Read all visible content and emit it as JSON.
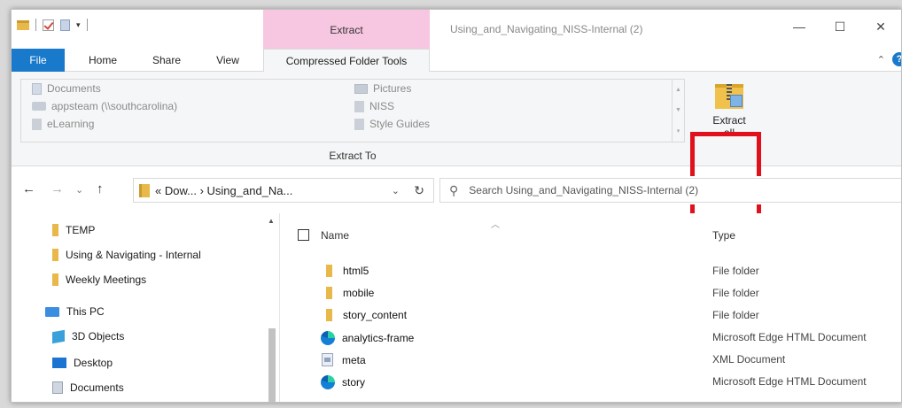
{
  "window": {
    "title": "Using_and_Navigating_NISS-Internal (2)",
    "context_tab_label": "Extract",
    "controls": {
      "minimize": "—",
      "maximize": "☐",
      "close": "✕"
    }
  },
  "qat": {
    "dropdown": "▾"
  },
  "tabs": {
    "file": "File",
    "home": "Home",
    "share": "Share",
    "view": "View",
    "compressed": "Compressed Folder Tools"
  },
  "tabrow_right": {
    "collapse": "⌃",
    "help": "?"
  },
  "ribbon": {
    "gallery": [
      {
        "label": "Documents",
        "icon": "documents-icon"
      },
      {
        "label": "appsteam (\\\\southcarolina)",
        "icon": "network-drive-icon"
      },
      {
        "label": "eLearning",
        "icon": "folder-icon"
      },
      {
        "label": "Pictures",
        "icon": "pictures-icon"
      },
      {
        "label": "NISS",
        "icon": "folder-icon"
      },
      {
        "label": "Style Guides",
        "icon": "folder-icon"
      }
    ],
    "group_label": "Extract To",
    "extract_all": {
      "line1": "Extract",
      "line2": "all"
    },
    "highlight_color": "#e0111c"
  },
  "navbar": {
    "back": "←",
    "forward": "→",
    "recent": "⌄",
    "up": "↑",
    "breadcrumb": "« Dow... › Using_and_Na...",
    "dropdown": "⌄",
    "refresh": "↻",
    "search_placeholder": "Search Using_and_Navigating_NISS-Internal (2)",
    "search_icon": "⚲"
  },
  "navpane": {
    "items": [
      {
        "label": "TEMP",
        "icon": "folder-icon"
      },
      {
        "label": "Using & Navigating - Internal",
        "icon": "folder-icon"
      },
      {
        "label": "Weekly Meetings",
        "icon": "folder-icon"
      },
      {
        "label": "This PC",
        "icon": "pc-icon"
      },
      {
        "label": "3D Objects",
        "icon": "3d-objects-icon"
      },
      {
        "label": "Desktop",
        "icon": "desktop-icon"
      },
      {
        "label": "Documents",
        "icon": "documents-icon"
      }
    ],
    "scroll_up": "▲"
  },
  "filelist": {
    "columns": {
      "name": "Name",
      "type": "Type",
      "sort": "︿"
    },
    "rows": [
      {
        "name": "html5",
        "type": "File folder",
        "icon": "folder-icon"
      },
      {
        "name": "mobile",
        "type": "File folder",
        "icon": "folder-icon"
      },
      {
        "name": "story_content",
        "type": "File folder",
        "icon": "folder-icon"
      },
      {
        "name": "analytics-frame",
        "type": "Microsoft Edge HTML Document",
        "icon": "edge-icon"
      },
      {
        "name": "meta",
        "type": "XML Document",
        "icon": "xml-icon"
      },
      {
        "name": "story",
        "type": "Microsoft Edge HTML Document",
        "icon": "edge-icon"
      }
    ]
  }
}
